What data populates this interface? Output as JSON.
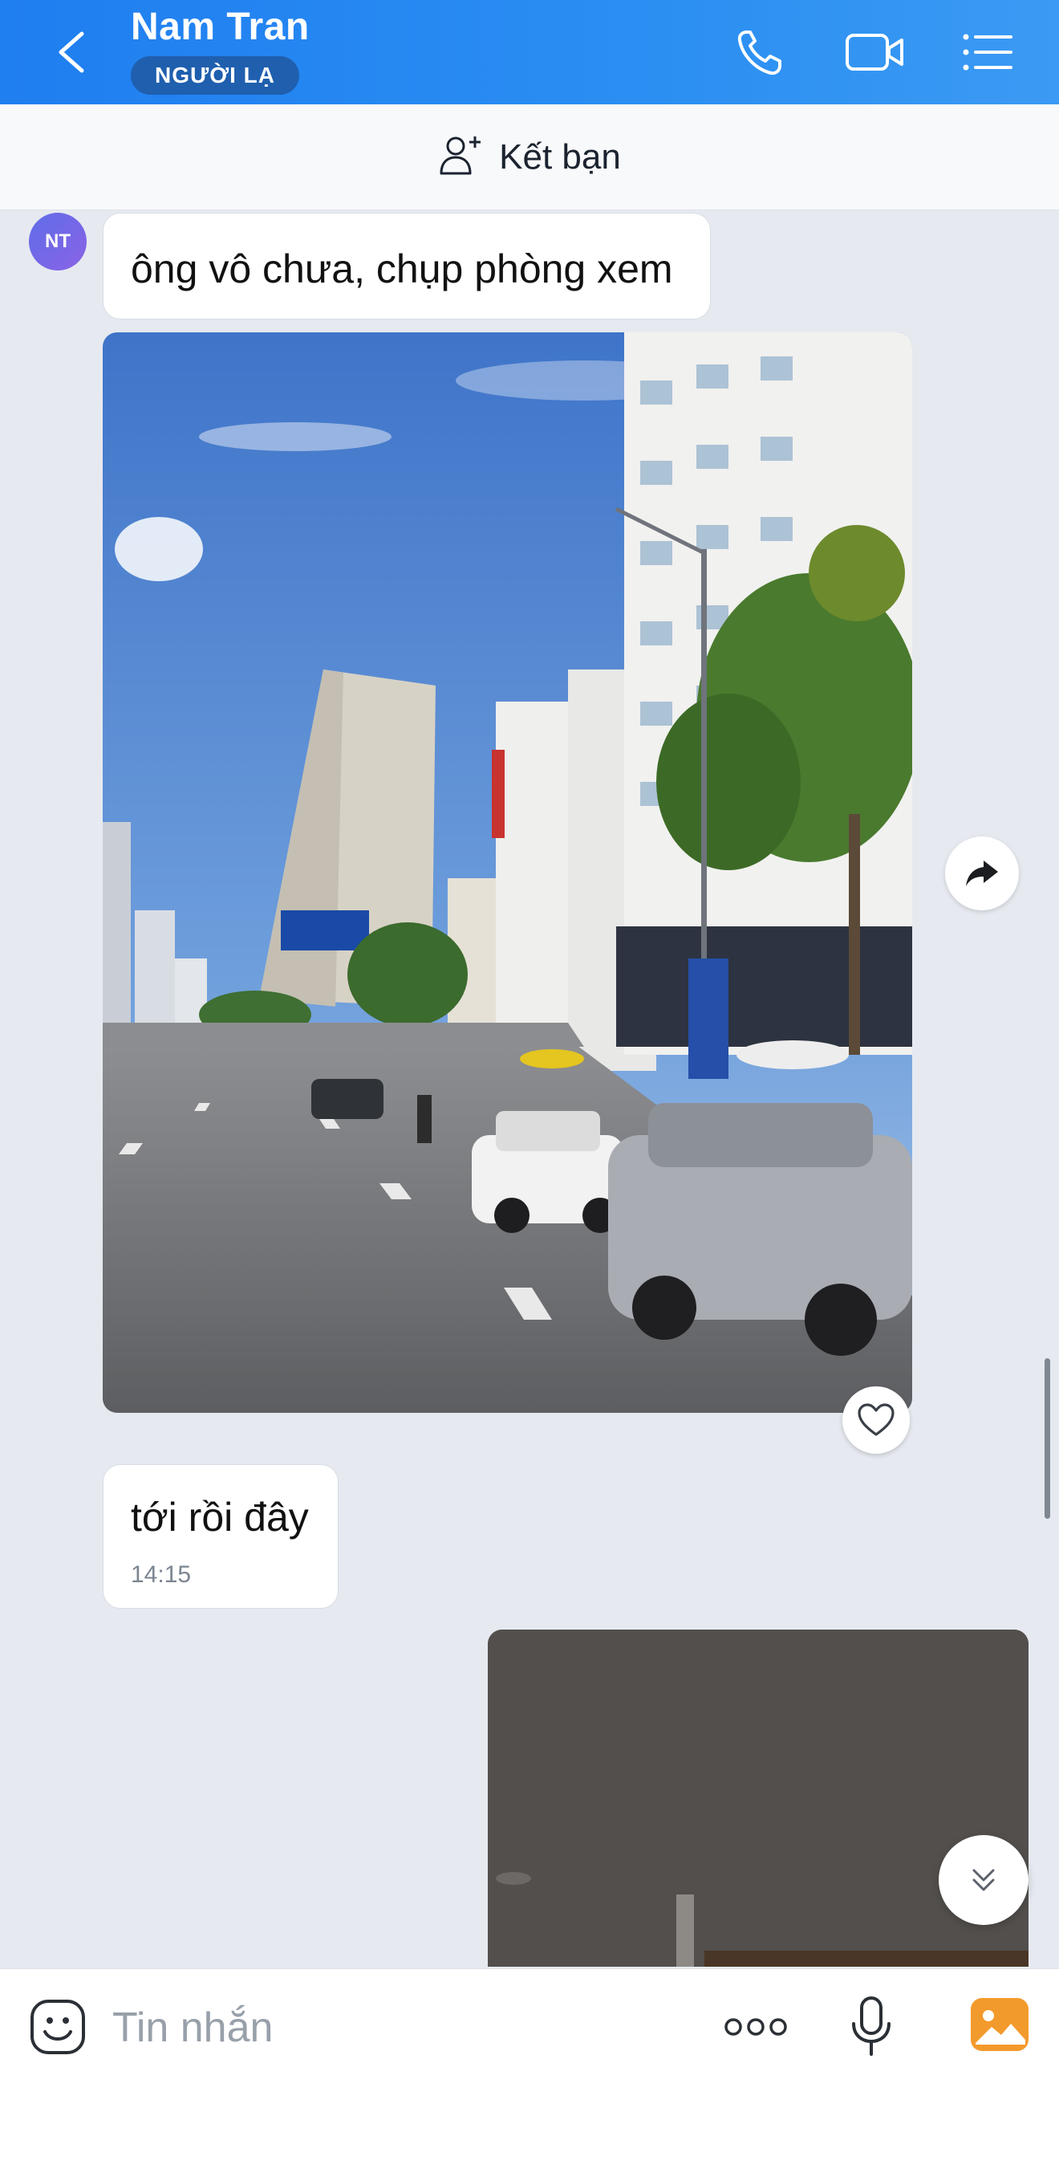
{
  "header": {
    "title": "Nam Tran",
    "badge": "NGƯỜI LẠ"
  },
  "friend_bar": {
    "label": "Kết bạn"
  },
  "contact": {
    "initials": "NT"
  },
  "messages": [
    {
      "type": "text",
      "from": "contact",
      "text": "ông vô chưa, chụp phòng xem"
    },
    {
      "type": "image",
      "from": "contact",
      "description_icon": "street-photo"
    },
    {
      "type": "text",
      "from": "contact",
      "text": "tới rồi đây",
      "time": "14:15"
    },
    {
      "type": "image",
      "from": "me",
      "description_icon": "room-photo"
    }
  ],
  "composer": {
    "placeholder": "Tin nhắn"
  },
  "colors": {
    "header_start": "#1f7ef0",
    "header_end": "#3b9af3",
    "badge_bg": "#1f5fae",
    "chat_bg": "#e6eaf0",
    "gallery_orange": "#f39a2c"
  },
  "icons": [
    "back-arrow-icon",
    "phone-icon",
    "video-icon",
    "menu-list-icon",
    "add-friend-icon",
    "share-forward-icon",
    "heart-icon",
    "chevron-double-down-icon",
    "emoji-icon",
    "more-dots-icon",
    "microphone-icon",
    "gallery-icon"
  ]
}
